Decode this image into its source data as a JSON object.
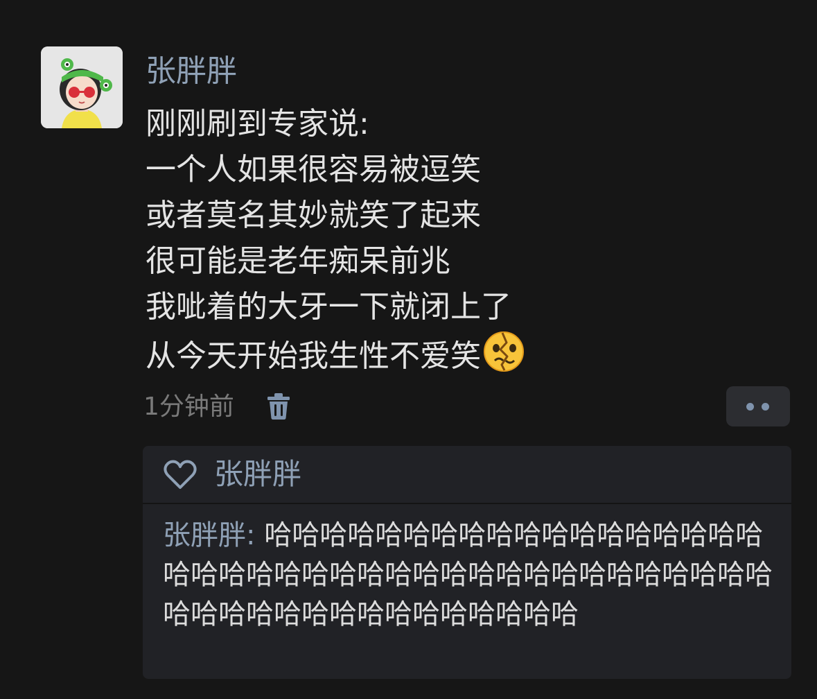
{
  "post": {
    "author": "张胖胖",
    "lines": [
      "刚刚刷到专家说:",
      "一个人如果很容易被逗笑",
      "或者莫名其妙就笑了起来",
      "很可能是老年痴呆前兆",
      "我呲着的大牙一下就闭上了",
      "从今天开始我生性不爱笑"
    ],
    "emoji": "heartbroken-face-emoji",
    "timestamp": "1分钟前"
  },
  "likes": {
    "names": "张胖胖"
  },
  "comment": {
    "author": "张胖胖",
    "separator": ": ",
    "text": "哈哈哈哈哈哈哈哈哈哈哈哈哈哈哈哈哈哈哈哈哈哈哈哈哈哈哈哈哈哈哈哈哈哈哈哈哈哈哈哈哈哈哈哈哈哈哈哈哈哈哈哈哈哈哈"
  },
  "colors": {
    "background": "#161616",
    "name_link": "#8fa1b6",
    "text": "#e4e4e4",
    "muted": "#7a7a7a",
    "comment_box": "#212226"
  },
  "icons": [
    "trash-icon",
    "more-dots-icon",
    "heart-outline-icon"
  ]
}
